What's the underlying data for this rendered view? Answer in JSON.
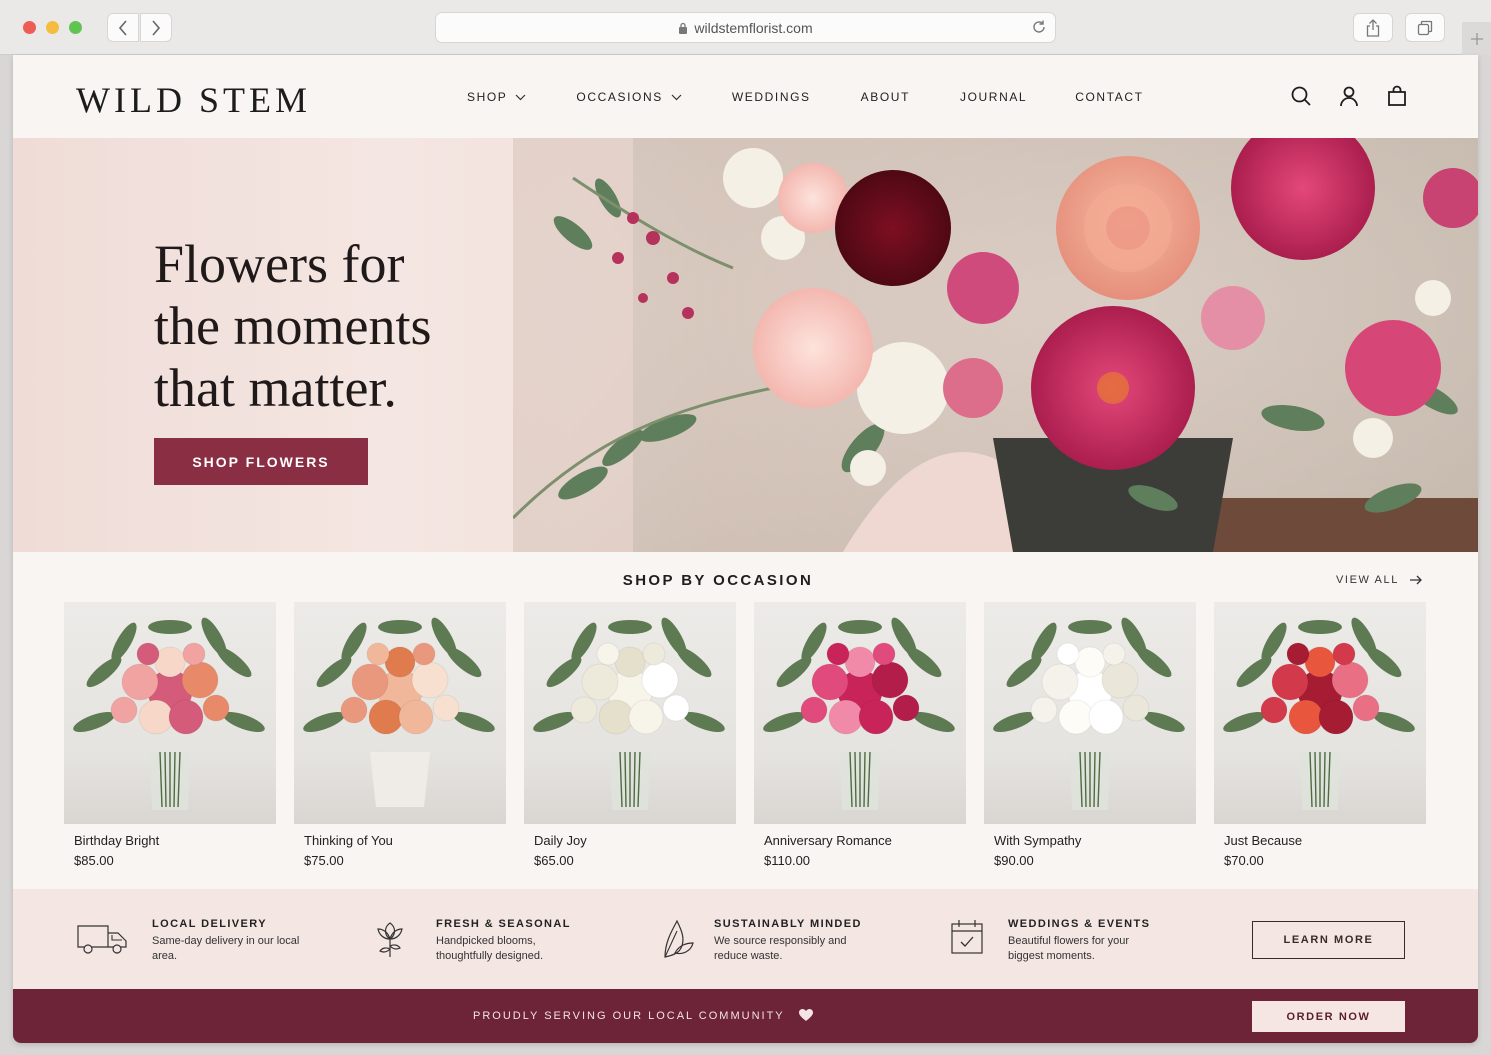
{
  "browser": {
    "url": "wildstemflorist.com"
  },
  "brand": {
    "logo": "WILD STEM",
    "accent": "#8a2e43",
    "footer_color": "#6d2338"
  },
  "nav": {
    "items": [
      {
        "label": "SHOP",
        "dropdown": true
      },
      {
        "label": "OCCASIONS",
        "dropdown": true
      },
      {
        "label": "WEDDINGS",
        "dropdown": false
      },
      {
        "label": "ABOUT",
        "dropdown": false
      },
      {
        "label": "JOURNAL",
        "dropdown": false
      },
      {
        "label": "CONTACT",
        "dropdown": false
      }
    ],
    "icons": [
      "search-icon",
      "account-icon",
      "bag-icon"
    ]
  },
  "hero": {
    "headline_lines": [
      "Flowers for",
      "the moments",
      "that matter."
    ],
    "cta": "SHOP FLOWERS"
  },
  "occasions": {
    "title": "SHOP BY OCCASION",
    "view_all": "VIEW ALL",
    "products": [
      {
        "name": "Birthday Bright",
        "price": "$85.00",
        "palette": [
          "#d45b7a",
          "#f0a3a0",
          "#e88a6a",
          "#f6d7c8"
        ]
      },
      {
        "name": "Thinking of You",
        "price": "$75.00",
        "palette": [
          "#f1b79a",
          "#e9987e",
          "#f7e0cf",
          "#e07b4e"
        ]
      },
      {
        "name": "Daily Joy",
        "price": "$65.00",
        "palette": [
          "#f7f4ea",
          "#eeeadb",
          "#ffffff",
          "#e5e0cc"
        ]
      },
      {
        "name": "Anniversary Romance",
        "price": "$110.00",
        "palette": [
          "#c8245a",
          "#e04a7c",
          "#b31d4a",
          "#f08aa8"
        ]
      },
      {
        "name": "With Sympathy",
        "price": "$90.00",
        "palette": [
          "#ffffff",
          "#f4f2ea",
          "#eae6d9",
          "#fdfcf7"
        ]
      },
      {
        "name": "Just Because",
        "price": "$70.00",
        "palette": [
          "#a51c33",
          "#d23a4c",
          "#e96f84",
          "#e8563d"
        ]
      }
    ]
  },
  "features": [
    {
      "icon": "delivery-truck-icon",
      "title": "LOCAL DELIVERY",
      "desc": "Same-day delivery in our local area."
    },
    {
      "icon": "flower-icon",
      "title": "FRESH & SEASONAL",
      "desc": "Handpicked blooms, thoughtfully designed."
    },
    {
      "icon": "leaf-icon",
      "title": "SUSTAINABLY MINDED",
      "desc": "We source responsibly and reduce waste."
    },
    {
      "icon": "calendar-icon",
      "title": "WEDDINGS & EVENTS",
      "desc": "Beautiful flowers for your biggest moments."
    }
  ],
  "learn_more": "LEARN MORE",
  "footer": {
    "tagline": "PROUDLY SERVING OUR LOCAL COMMUNITY",
    "order": "ORDER NOW"
  }
}
